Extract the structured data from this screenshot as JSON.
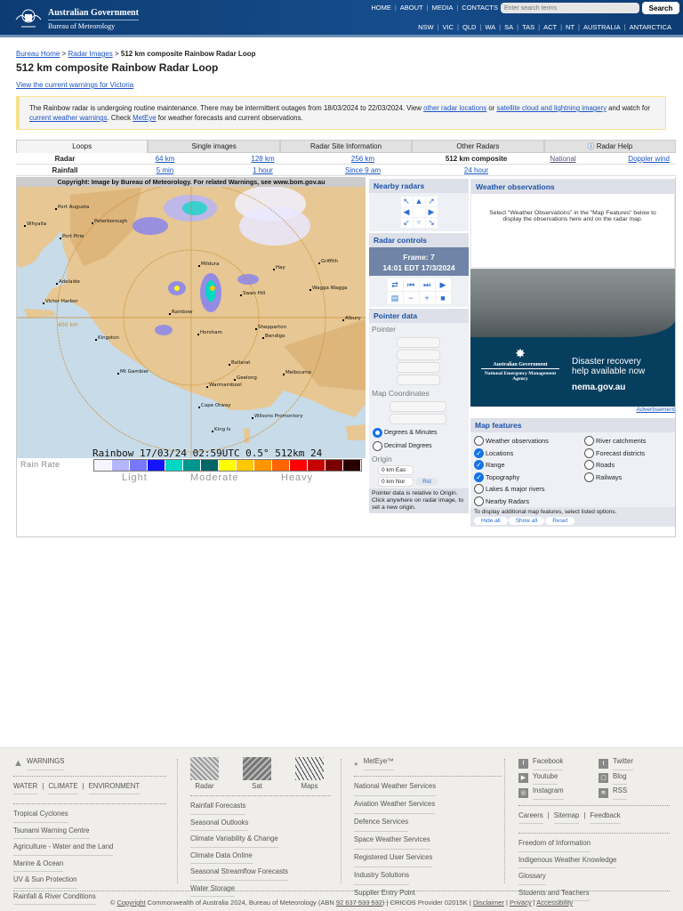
{
  "header": {
    "gov": "Australian Government",
    "agency": "Bureau of Meteorology",
    "top_links": [
      "HOME",
      "ABOUT",
      "MEDIA",
      "CONTACTS"
    ],
    "search_placeholder": "Enter search terms",
    "search_button": "Search",
    "states": [
      "NSW",
      "VIC",
      "QLD",
      "WA",
      "SA",
      "TAS",
      "ACT",
      "NT",
      "AUSTRALIA",
      "ANTARCTICA"
    ]
  },
  "breadcrumb": {
    "home": "Bureau Home",
    "sep": ">",
    "radar": "Radar Images",
    "current": "512 km composite Rainbow Radar Loop"
  },
  "page_title": "512 km composite Rainbow Radar Loop",
  "warnings_link": "View the current warnings for Victoria",
  "notice": {
    "t1": "The Rainbow radar is undergoing routine maintenance. There may be intermittent outages from 18/03/2024 to 22/03/2024. View ",
    "l1": "other radar locations",
    "t2": " or ",
    "l2": "satellite cloud and lightning imagery",
    "t3": " and watch for ",
    "l3": "current weather warnings",
    "t4": ". Check ",
    "l4": "MetEye",
    "t5": " for weather forecasts and current observations."
  },
  "tabs": [
    "Loops",
    "Single images",
    "Radar Site Information",
    "Other Radars",
    "Radar Help"
  ],
  "radar_row": {
    "label": "Radar",
    "items": [
      "64 km",
      "128 km",
      "256 km",
      "512 km composite",
      "National",
      "Doppler wind"
    ]
  },
  "rainfall_row": {
    "label": "Rainfall",
    "items": [
      "5 min",
      "1 hour",
      "Since 9 am",
      "24 hour"
    ]
  },
  "radar_image": {
    "copyright": "Copyright: Image by Bureau of Meteorology. For related Warnings, see www.bom.gov.au",
    "stamp": "Rainbow 17/03/24 02:59UTC 0.5° 512km 24",
    "range_label": "400 km",
    "places": [
      [
        "Port Augusta",
        44,
        36
      ],
      [
        "Peterborough",
        85,
        52
      ],
      [
        "Whyalla",
        9,
        55
      ],
      [
        "Port Pirie",
        49,
        69
      ],
      [
        "Adelaide",
        45,
        120
      ],
      [
        "Victor Harbor",
        30,
        142
      ],
      [
        "Kingston",
        89,
        183
      ],
      [
        "Mt Gambier",
        114,
        221
      ],
      [
        "Mildura",
        205,
        100
      ],
      [
        "Rainbow",
        172,
        154
      ],
      [
        "Horsham",
        204,
        177
      ],
      [
        "Swan Hill",
        252,
        133
      ],
      [
        "Hay",
        289,
        104
      ],
      [
        "Griffith",
        340,
        97
      ],
      [
        "Wagga Wagga",
        330,
        127
      ],
      [
        "Albury",
        367,
        161
      ],
      [
        "Shepparton",
        269,
        171
      ],
      [
        "Bendigo",
        277,
        181
      ],
      [
        "Ballarat",
        239,
        211
      ],
      [
        "Melbourne",
        300,
        222
      ],
      [
        "Geelong",
        245,
        228
      ],
      [
        "Warrnambool",
        214,
        236
      ],
      [
        "Cape Otway",
        205,
        259
      ],
      [
        "Wilsons Promontory",
        265,
        271
      ],
      [
        "King Is",
        220,
        286
      ]
    ]
  },
  "legend": {
    "title": "Rain Rate",
    "light": "Light",
    "moderate": "Moderate",
    "heavy": "Heavy",
    "colors": [
      "#f5f5ff",
      "#b4b4ff",
      "#7878ff",
      "#1414ff",
      "#00d8c3",
      "#009690",
      "#006666",
      "#ffff00",
      "#ffc800",
      "#ff9600",
      "#ff6400",
      "#ff0000",
      "#c80000",
      "#780000",
      "#280000"
    ]
  },
  "nearby": {
    "title": "Nearby radars"
  },
  "controls": {
    "title": "Radar controls",
    "frame": "Frame: 7",
    "time": "14:01 EDT 17/3/2024"
  },
  "pointer": {
    "title": "Pointer data",
    "pointer": "Pointer",
    "map_coords": "Map Coordinates",
    "deg_min": "Degrees & Minutes",
    "dec_deg": "Decimal Degrees",
    "origin": "Origin",
    "east": "0 km Eas",
    "north": "0 km Nor",
    "rst": "Rst",
    "note": "Pointer data is relative to Origin. Click anywhere on radar image, to set a new origin."
  },
  "observations": {
    "title": "Weather observations",
    "text": "Select \"Weather Observations\" in the \"Map Features\" below to display the observations here and on the radar map."
  },
  "ad": {
    "gov": "Australian Government",
    "agency": "National Emergency Management Agency",
    "line1": "Disaster recovery",
    "line2": "help available now",
    "url": "nema.gov.au",
    "label": "Advertisement"
  },
  "map_features": {
    "title": "Map features",
    "left": [
      [
        "Weather observations",
        false
      ],
      [
        "Locations",
        true
      ],
      [
        "Range",
        true
      ],
      [
        "Topography",
        true
      ],
      [
        "Lakes & major rivers",
        false
      ],
      [
        "Nearby Radars",
        false
      ]
    ],
    "right": [
      [
        "River catchments",
        false
      ],
      [
        "Forecast districts",
        false
      ],
      [
        "Roads",
        false
      ],
      [
        "Railways",
        false
      ]
    ],
    "note": "To display additional map features, select listed options.",
    "hide": "Hide all",
    "show": "Show all",
    "reset": "Reset"
  },
  "footer": {
    "warnings": "WARNINGS",
    "wce": [
      "WATER",
      "CLIMATE",
      "ENVIRONMENT"
    ],
    "col1": [
      "Tropical Cyclones",
      "Tsunami Warning Centre",
      "Agriculture - Water and the Land",
      "Marine & Ocean",
      "UV & Sun Protection",
      "Rainfall & River Conditions"
    ],
    "thumbs": [
      "Radar",
      "Sat",
      "Maps"
    ],
    "col2": [
      "Rainfall Forecasts",
      "Seasonal Outlooks",
      "Climate Variability & Change",
      "Climate Data Online",
      "Seasonal Streamflow Forecasts",
      "Water Storage"
    ],
    "meteye": "MetEye™",
    "col3": [
      "National Weather Services",
      "Aviation Weather Services",
      "Defence Services",
      "Space Weather Services",
      "Registered User Services",
      "Industry Solutions",
      "Supplier Entry Point"
    ],
    "social": [
      "Facebook",
      "Twitter",
      "Youtube",
      "Blog",
      "Instagram",
      "RSS"
    ],
    "csf": [
      "Careers",
      "Sitemap",
      "Feedback"
    ],
    "col4": [
      "Freedom of Information",
      "Indigenous Weather Knowledge",
      "Glossary",
      "Students and Teachers"
    ],
    "copy": {
      "c": "©",
      "copyright": "Copyright",
      "t1": " Commonwealth of Australia 2024, Bureau of Meteorology (ABN ",
      "abn": "92 637 533 532",
      "t2": ") | CRICOS Provider 02015K | ",
      "disclaimer": "Disclaimer",
      "privacy": "Privacy",
      "accessibility": "Accessibility"
    }
  }
}
